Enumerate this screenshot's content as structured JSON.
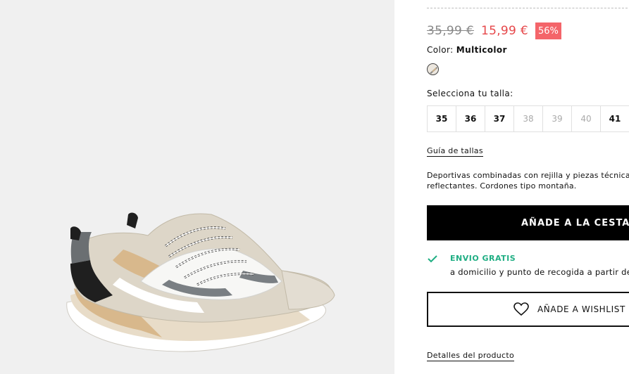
{
  "product_image": {
    "alt_icon": "sneaker-image"
  },
  "price": {
    "old": "35,99 €",
    "new": "15,99 €",
    "discount": "56%"
  },
  "color": {
    "label": "Color:",
    "value": "Multicolor",
    "swatch_icon": "multicolor-swatch-icon"
  },
  "sizes": {
    "label": "Selecciona tu talla:",
    "options": [
      {
        "value": "35",
        "available": true
      },
      {
        "value": "36",
        "available": true
      },
      {
        "value": "37",
        "available": true
      },
      {
        "value": "38",
        "available": false
      },
      {
        "value": "39",
        "available": false
      },
      {
        "value": "40",
        "available": false
      },
      {
        "value": "41",
        "available": true
      }
    ]
  },
  "size_guide": "Guía de tallas",
  "description": "Deportivas combinadas con rejilla y piezas técnica\nreflectantes. Cordones tipo montaña.",
  "add_to_cart": "AÑADE A LA CESTA",
  "shipping": {
    "title": "ENVIO GRATIS",
    "subtitle": "a domicilio y punto de recogida a partir de",
    "icon": "check-icon"
  },
  "wishlist": {
    "label": "AÑADE A WISHLIST",
    "icon": "heart-icon"
  },
  "details_link": "Detalles del producto",
  "colors": {
    "sale_red": "#e6474a",
    "badge_red": "#f4656a",
    "ship_green": "#1fae83",
    "button_black": "#000000"
  }
}
